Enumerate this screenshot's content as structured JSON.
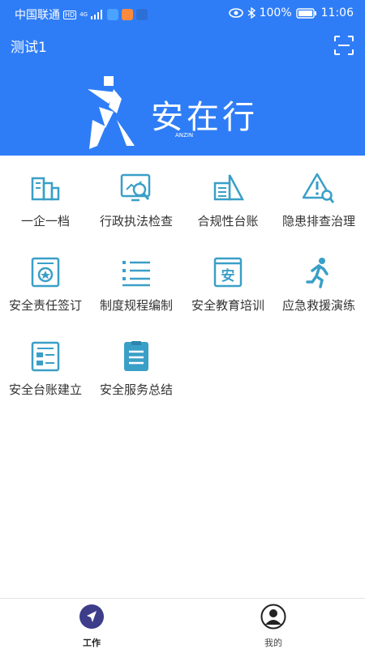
{
  "status_bar": {
    "carrier": "中国联通",
    "hd_badge": "HD",
    "network_type": "4G",
    "battery": "100%",
    "time": "11:06"
  },
  "header": {
    "title": "测试1",
    "brand_name": "安在行",
    "brand_sub": "ANZIN",
    "scan_icon": "scan-icon"
  },
  "grid": {
    "items": [
      {
        "label": "一企一档",
        "icon": "building-icon"
      },
      {
        "label": "行政执法检查",
        "icon": "inspection-chart-icon"
      },
      {
        "label": "合规性台账",
        "icon": "ledger-icon"
      },
      {
        "label": "隐患排查治理",
        "icon": "hazard-search-icon"
      },
      {
        "label": "安全责任签订",
        "icon": "certificate-icon"
      },
      {
        "label": "制度规程编制",
        "icon": "list-icon"
      },
      {
        "label": "安全教育培训",
        "icon": "education-book-icon"
      },
      {
        "label": "应急救援演练",
        "icon": "running-person-icon"
      },
      {
        "label": "安全台账建立",
        "icon": "form-icon"
      },
      {
        "label": "安全服务总结",
        "icon": "clipboard-icon"
      }
    ]
  },
  "tabbar": {
    "tabs": [
      {
        "label": "工作",
        "icon": "navigation-arrow-icon",
        "active": true
      },
      {
        "label": "我的",
        "icon": "user-icon",
        "active": false
      }
    ]
  },
  "colors": {
    "brand_blue": "#2f7df6",
    "icon_teal": "#3a9fc7",
    "tab_active": "#3d3d8a"
  }
}
